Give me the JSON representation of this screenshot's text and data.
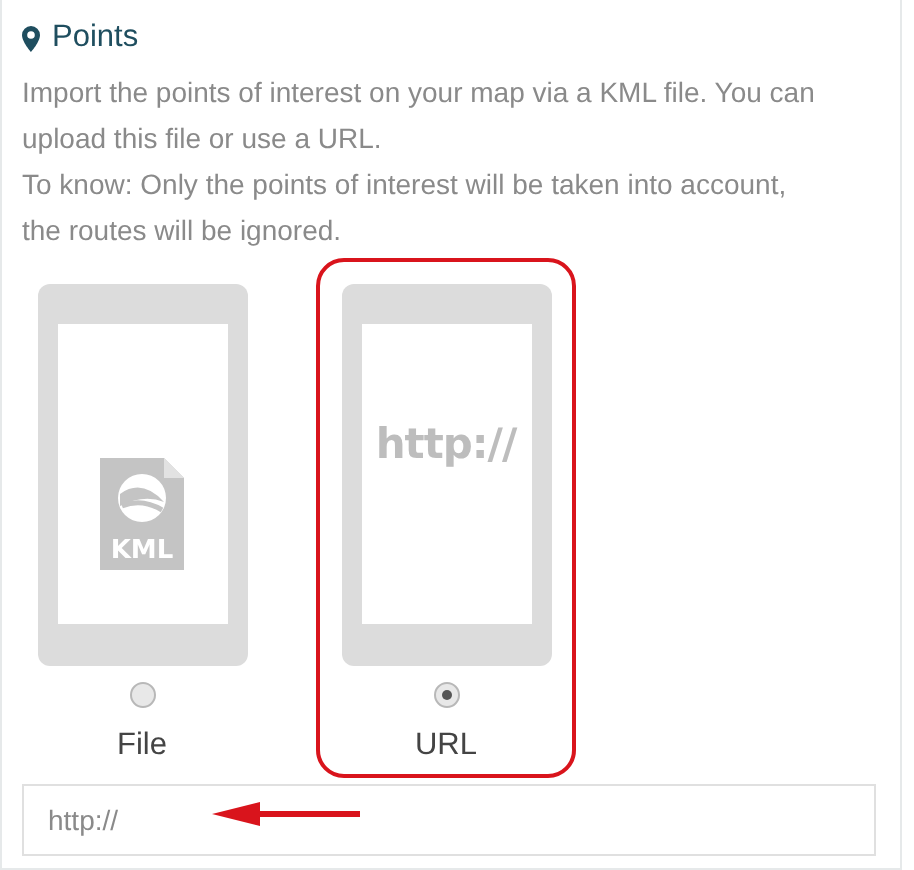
{
  "section": {
    "title": "Points"
  },
  "description": [
    "Import the points of interest on your map via a KML file. You can upload this file or use a URL.",
    "To know: Only the points of interest will be taken into account, the routes will be ignored."
  ],
  "options": [
    {
      "kind": "file",
      "label": "File",
      "icon_text": "KML",
      "selected": false
    },
    {
      "kind": "url",
      "label": "URL",
      "icon_text": "http://",
      "selected": true
    }
  ],
  "url_field": {
    "value": "http://"
  },
  "annotations": {
    "highlight_selected": true,
    "arrow_to_field": true
  }
}
